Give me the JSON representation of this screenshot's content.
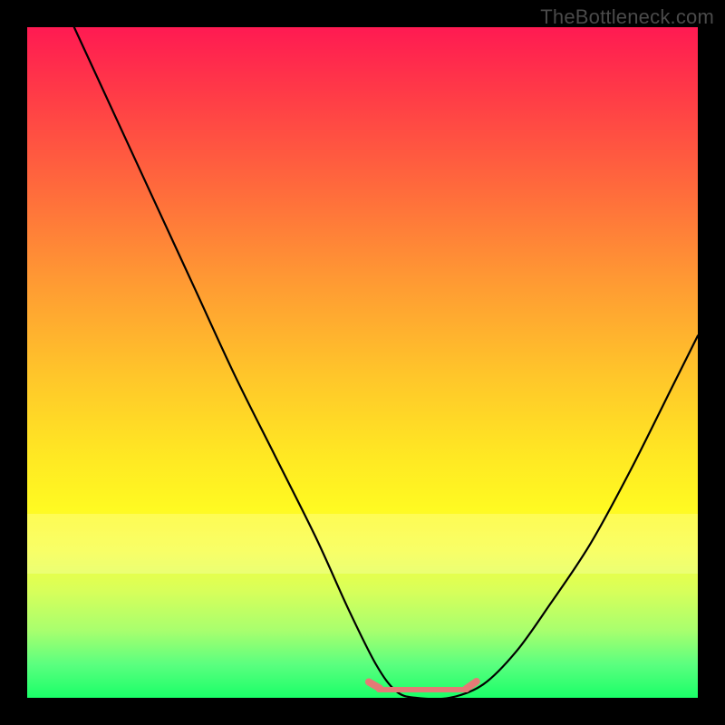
{
  "watermark": "TheBottleneck.com",
  "colors": {
    "curve": "#000000",
    "baseline": "#e47a76",
    "gradient_top": "#ff1a52",
    "gradient_bottom": "#1aff68"
  },
  "chart_data": {
    "type": "line",
    "title": "",
    "xlabel": "",
    "ylabel": "",
    "xlim": [
      0,
      100
    ],
    "ylim": [
      0,
      100
    ],
    "series": [
      {
        "name": "curve",
        "x": [
          7,
          13,
          19,
          25,
          31,
          37,
          43,
          48,
          52,
          55,
          58,
          63,
          68,
          73,
          78,
          84,
          90,
          96,
          100
        ],
        "y": [
          100,
          87,
          74,
          61,
          48,
          36,
          24,
          13,
          5,
          1,
          0,
          0,
          2,
          7,
          14,
          23,
          34,
          46,
          54
        ]
      }
    ],
    "baseline": {
      "x_start": 52,
      "x_end": 66,
      "y": 1.2,
      "left_cap_angle_deg": -60,
      "right_cap_angle_deg": 55
    },
    "annotations": []
  }
}
